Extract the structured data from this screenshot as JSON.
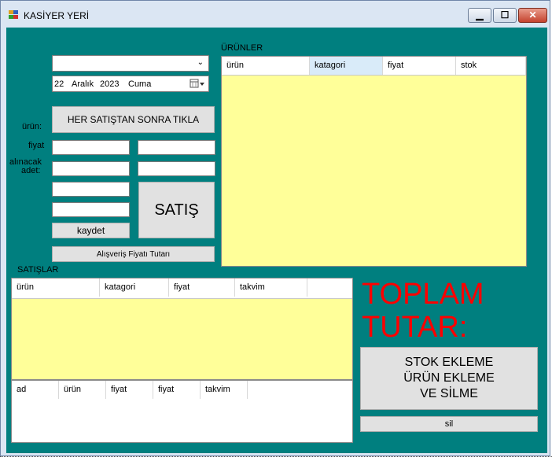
{
  "window": {
    "title": "KASİYER YERİ",
    "controls": {
      "minimize": "▁",
      "maximize": "☐",
      "close": "✕"
    }
  },
  "left_panel": {
    "date_picker": {
      "day": "22",
      "month": "Aralık",
      "year": "2023",
      "weekday": "Cuma"
    },
    "after_sale_button": "HER SATIŞTAN SONRA TIKLA",
    "labels": {
      "product": "ürün:",
      "price": "fiyat",
      "quantity_line1": "alınacak",
      "quantity_line2": "adet:"
    },
    "sell_button": "SATIŞ",
    "save_button": "kaydet",
    "shopping_total_button": "Alışveriş Fiyatı Tutarı"
  },
  "products": {
    "title": "ÜRÜNLER",
    "columns": [
      "ürün",
      "katagori",
      "fiyat",
      "stok"
    ]
  },
  "sales": {
    "title": "SATIŞLAR",
    "columns": [
      "ürün",
      "katagori",
      "fiyat",
      "takvim"
    ]
  },
  "records": {
    "columns": [
      "ad",
      "ürün",
      "fiyat",
      "fiyat",
      "takvim"
    ]
  },
  "total": {
    "line1": "TOPLAM",
    "line2": "TUTAR:"
  },
  "stock_button": {
    "line1": "STOK EKLEME",
    "line2": "ÜRÜN EKLEME",
    "line3": "VE SİLME"
  },
  "delete_button": "sil",
  "colors": {
    "background": "#007f7f",
    "grid": "#ffff99",
    "total_text": "#ff0000"
  }
}
